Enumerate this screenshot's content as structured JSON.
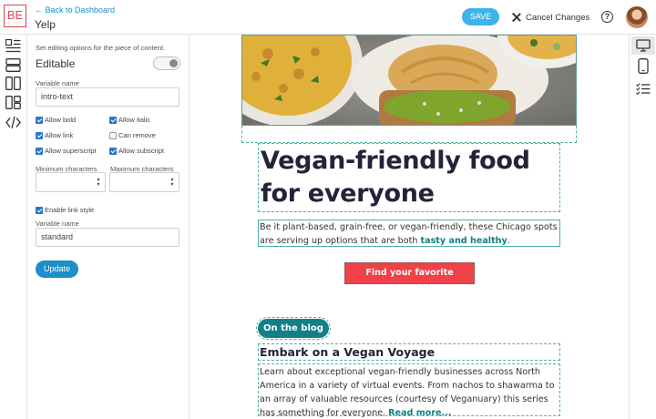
{
  "header": {
    "logo_text": "BE",
    "back_link": "← Back to Dashboard",
    "title": "Yelp",
    "save_label": "SAVE",
    "cancel_label": "Cancel Changes",
    "help_icon": "?"
  },
  "left_rail": {
    "icons": [
      "content-list-icon",
      "rows-layout-icon",
      "columns-layout-icon",
      "grid-layout-icon",
      "code-icon"
    ]
  },
  "panel": {
    "description": "Set editing options for the piece of content.",
    "editable_label": "Editable",
    "variable_name_label": "Variable name",
    "variable_name_value": "intro-text",
    "checkboxes": [
      {
        "label": "Allow bold",
        "checked": true
      },
      {
        "label": "Allow italic",
        "checked": true
      },
      {
        "label": "Allow link",
        "checked": true
      },
      {
        "label": "Can remove",
        "checked": false
      },
      {
        "label": "Allow superscript",
        "checked": true
      },
      {
        "label": "Allow subscript",
        "checked": true
      }
    ],
    "min_chars_label": "Minimum characters",
    "max_chars_label": "Maximum characters",
    "link_style_label": "Enable link style",
    "link_style_checked": true,
    "link_var_label": "Variable name",
    "link_var_value": "standard",
    "update_label": "Update"
  },
  "preview": {
    "headline": "Vegan-friendly food for everyone",
    "intro_text": "Be it plant-based, grain-free, or vegan-friendly, these Chicago spots are serving up options that are both ",
    "intro_link": "tasty and healthy",
    "intro_end": ".",
    "cta_label": "Find your favorite",
    "blog_pill": "On the blog",
    "blog_title": "Embark on a Vegan Voyage",
    "blog_body": "Learn about exceptional vegan-friendly businesses across North America in a variety of virtual events. From nachos to shawarma to an array of valuable resources (courtesy of Veganuary) this series has something for everyone. ",
    "read_more": "Read more..."
  },
  "right_rail": {
    "icons": [
      "desktop-icon",
      "mobile-icon",
      "checklist-icon"
    ]
  },
  "colors": {
    "accent_blue": "#1c8fc6",
    "save_blue": "#3bb5e8",
    "teal": "#11808a",
    "cta_red": "#ef4147",
    "logo_red": "#e0454f"
  }
}
